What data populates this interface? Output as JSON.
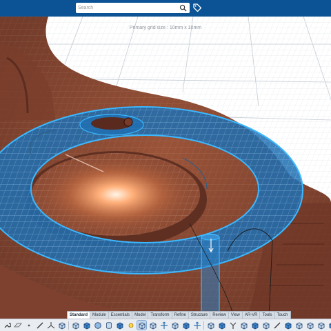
{
  "search": {
    "placeholder": "Search"
  },
  "icons": {
    "search": "magnifier-icon",
    "tag": "tag-icon"
  },
  "viewport": {
    "grid_caption": "Primary grid size : 10mm x 10mm"
  },
  "colors": {
    "top_bar": "#0b5394",
    "selection_fill": "#1f6fb2",
    "selection_edge": "#39b6ff",
    "model": "#8a4a34",
    "toolbar": "#e9edf2"
  },
  "ribbon": {
    "active_tab": "Standard",
    "tabs": [
      "Standard",
      "Module",
      "Essentials",
      "Model",
      "Transform",
      "Refine",
      "Structure",
      "Review",
      "View",
      "AR-VR",
      "Tools",
      "Touch"
    ]
  },
  "toolbar": {
    "tools": [
      "wrench-icon",
      "plane-icon",
      "point-icon",
      "line-icon",
      "axis-icon",
      "cube-icon",
      "cube-wire-icon",
      "primitive-icon",
      "sphere-icon",
      "cylinder-icon",
      "cube-solid-icon",
      "light-icon",
      "cube-select-icon",
      "cube-frame-icon",
      "transform-icon",
      "cube-grid-icon",
      "split-icon",
      "align-icon",
      "snap-icon",
      "mirror-icon",
      "fork-icon",
      "cube-cut-icon",
      "cube-blue-icon",
      "section-icon",
      "measure-icon",
      "layer-icon",
      "box-plus-icon",
      "box-minus-icon",
      "box-icon",
      "box-blue-icon",
      "box-orange-icon"
    ]
  }
}
